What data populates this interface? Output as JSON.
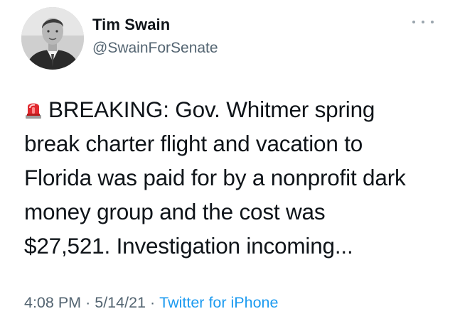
{
  "author": {
    "display_name": "Tim Swain",
    "handle": "@SwainForSenate",
    "avatar_icon": "profile-photo"
  },
  "more_menu_icon": "ellipsis-icon",
  "tweet": {
    "emoji": "police-car-light",
    "lines": [
      "BREAKING: Gov. Whitmer spring",
      "break charter flight and vacation to",
      "Florida was paid for by a nonprofit dark",
      "money group and the cost was",
      "$27,521. Investigation incoming..."
    ]
  },
  "meta": {
    "time": "4:08 PM",
    "separator": "·",
    "date": "5/14/21",
    "source": "Twitter for iPhone"
  },
  "colors": {
    "text": "#0f1419",
    "muted": "#536471",
    "link": "#1d9bf0",
    "siren": "#e0282e"
  }
}
